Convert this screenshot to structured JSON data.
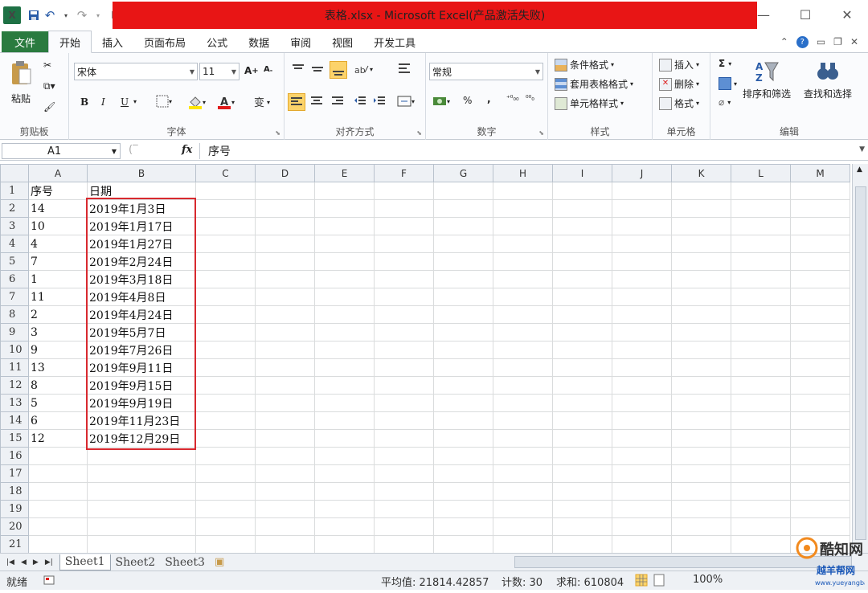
{
  "window": {
    "title": "表格.xlsx - Microsoft Excel(产品激活失败)",
    "minimize": "—",
    "maximize": "☐",
    "close": "✕"
  },
  "qat": {
    "logo": "X",
    "save": "💾",
    "undo": "↶",
    "redo": "↷",
    "customize": "▾"
  },
  "tabs": [
    "文件",
    "开始",
    "插入",
    "页面布局",
    "公式",
    "数据",
    "审阅",
    "视图",
    "开发工具"
  ],
  "active_tab": "开始",
  "ribbon": {
    "clipboard": {
      "paste": "粘贴",
      "label": "剪贴板"
    },
    "font": {
      "name": "宋体",
      "size": "11",
      "bold": "B",
      "italic": "I",
      "underline": "U",
      "label": "字体"
    },
    "align": {
      "label": "对齐方式"
    },
    "number": {
      "format": "常规",
      "percent": "%",
      "comma": ",",
      "label": "数字"
    },
    "styles": {
      "conditional": "条件格式",
      "table": "套用表格格式",
      "cell": "单元格样式",
      "label": "样式"
    },
    "cells": {
      "insert": "插入",
      "delete": "删除",
      "format": "格式",
      "label": "单元格"
    },
    "editing": {
      "sum": "Σ",
      "sort": "排序和筛选",
      "find": "查找和选择",
      "label": "编辑"
    }
  },
  "formula_bar": {
    "name_box": "A1",
    "fx": "fx",
    "value": "序号"
  },
  "columns": [
    "A",
    "B",
    "C",
    "D",
    "E",
    "F",
    "G",
    "H",
    "I",
    "J",
    "K",
    "L",
    "M"
  ],
  "rows": [
    [
      "序号",
      "日期"
    ],
    [
      "14",
      "2019年1月3日"
    ],
    [
      "10",
      "2019年1月17日"
    ],
    [
      "4",
      "2019年1月27日"
    ],
    [
      "7",
      "2019年2月24日"
    ],
    [
      "1",
      "2019年3月18日"
    ],
    [
      "11",
      "2019年4月8日"
    ],
    [
      "2",
      "2019年4月24日"
    ],
    [
      "3",
      "2019年5月7日"
    ],
    [
      "9",
      "2019年7月26日"
    ],
    [
      "13",
      "2019年9月11日"
    ],
    [
      "8",
      "2019年9月15日"
    ],
    [
      "5",
      "2019年9月19日"
    ],
    [
      "6",
      "2019年11月23日"
    ],
    [
      "12",
      "2019年12月29日"
    ],
    [
      "",
      ""
    ],
    [
      "",
      ""
    ],
    [
      "",
      ""
    ],
    [
      "",
      ""
    ],
    [
      "",
      ""
    ],
    [
      "",
      ""
    ]
  ],
  "sheets": [
    "Sheet1",
    "Sheet2",
    "Sheet3"
  ],
  "status": {
    "ready": "就绪",
    "average": "平均值: 21814.42857",
    "count": "计数: 30",
    "sum": "求和: 610804",
    "zoom": "100%"
  },
  "watermark": {
    "brand": "酷知网",
    "sub": "越羊帮网",
    "url": "www.yueyangbang.com"
  }
}
